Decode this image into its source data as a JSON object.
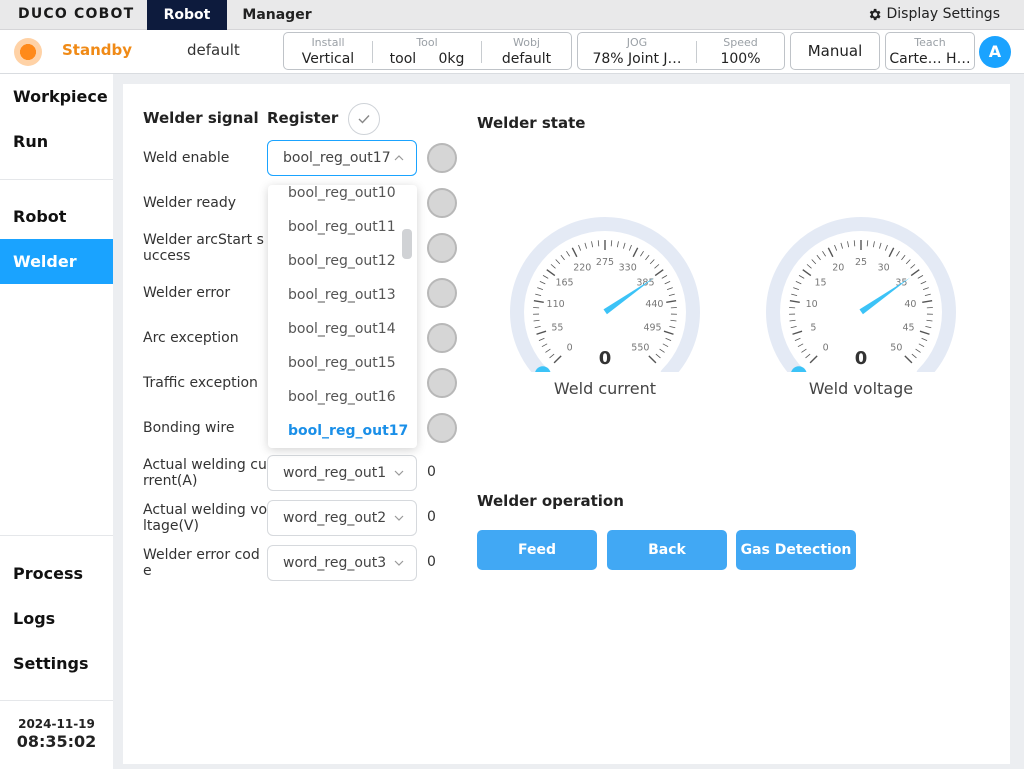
{
  "app": {
    "logo": "DUCO COBOT"
  },
  "tabs": [
    {
      "label": "Robot"
    },
    {
      "label": "Manager"
    }
  ],
  "display_settings": "Display Settings",
  "status": {
    "state": "Standby",
    "profile": "default",
    "install": {
      "label": "Install",
      "value": "Vertical"
    },
    "tool": {
      "label": "Tool",
      "name": "tool",
      "load": "0kg"
    },
    "wobj": {
      "label": "Wobj",
      "value": "default"
    },
    "jog": {
      "label": "JOG",
      "value": "78%  Joint J…"
    },
    "speed": {
      "label": "Speed",
      "value": "100%"
    },
    "mode": "Manual",
    "teach": {
      "label": "Teach",
      "value": "Carte… H…"
    },
    "user_initial": "A"
  },
  "sidebar": {
    "items": [
      {
        "label": "Workpiece"
      },
      {
        "label": "Run"
      },
      {
        "label": "Robot"
      },
      {
        "label": "Welder"
      },
      {
        "label": "Process"
      },
      {
        "label": "Logs"
      },
      {
        "label": "Settings"
      }
    ],
    "date": "2024-11-19",
    "time": "08:35:02"
  },
  "signals": {
    "title": "Welder signal",
    "register_title": "Register",
    "rows": [
      {
        "label": "Weld enable",
        "register": "bool_reg_out17"
      },
      {
        "label": "Welder ready"
      },
      {
        "label": "Welder arcStart s uccess"
      },
      {
        "label": "Welder error"
      },
      {
        "label": "Arc exception"
      },
      {
        "label": "Traffic exception"
      },
      {
        "label": "Bonding wire"
      },
      {
        "label": "Actual welding cu rrent(A)",
        "register": "word_reg_out1",
        "value": "0"
      },
      {
        "label": "Actual welding vo ltage(V)",
        "register": "word_reg_out2",
        "value": "0"
      },
      {
        "label": "Welder error cod e",
        "register": "word_reg_out3",
        "value": "0"
      }
    ],
    "dropdown_options": [
      "bool_reg_out10",
      "bool_reg_out11",
      "bool_reg_out12",
      "bool_reg_out13",
      "bool_reg_out14",
      "bool_reg_out15",
      "bool_reg_out16",
      "bool_reg_out17"
    ],
    "dropdown_selected": "bool_reg_out17"
  },
  "welder_state": {
    "title": "Welder state",
    "current": {
      "label": "Weld current",
      "value": "0",
      "ticks": [
        "0",
        "55",
        "110",
        "165",
        "220",
        "275",
        "330",
        "385",
        "440",
        "495",
        "550"
      ]
    },
    "voltage": {
      "label": "Weld voltage",
      "value": "0",
      "ticks": [
        "0",
        "5",
        "10",
        "15",
        "20",
        "25",
        "30",
        "35",
        "40",
        "45",
        "50"
      ]
    }
  },
  "operation": {
    "title": "Welder operation",
    "buttons": [
      {
        "label": "Feed"
      },
      {
        "label": "Back"
      },
      {
        "label": "Gas Detection"
      }
    ]
  },
  "colors": {
    "accent": "#1aa3ff",
    "standby": "#f08a16",
    "button": "#41a8f4",
    "nav_dark": "#0d1b3d"
  }
}
